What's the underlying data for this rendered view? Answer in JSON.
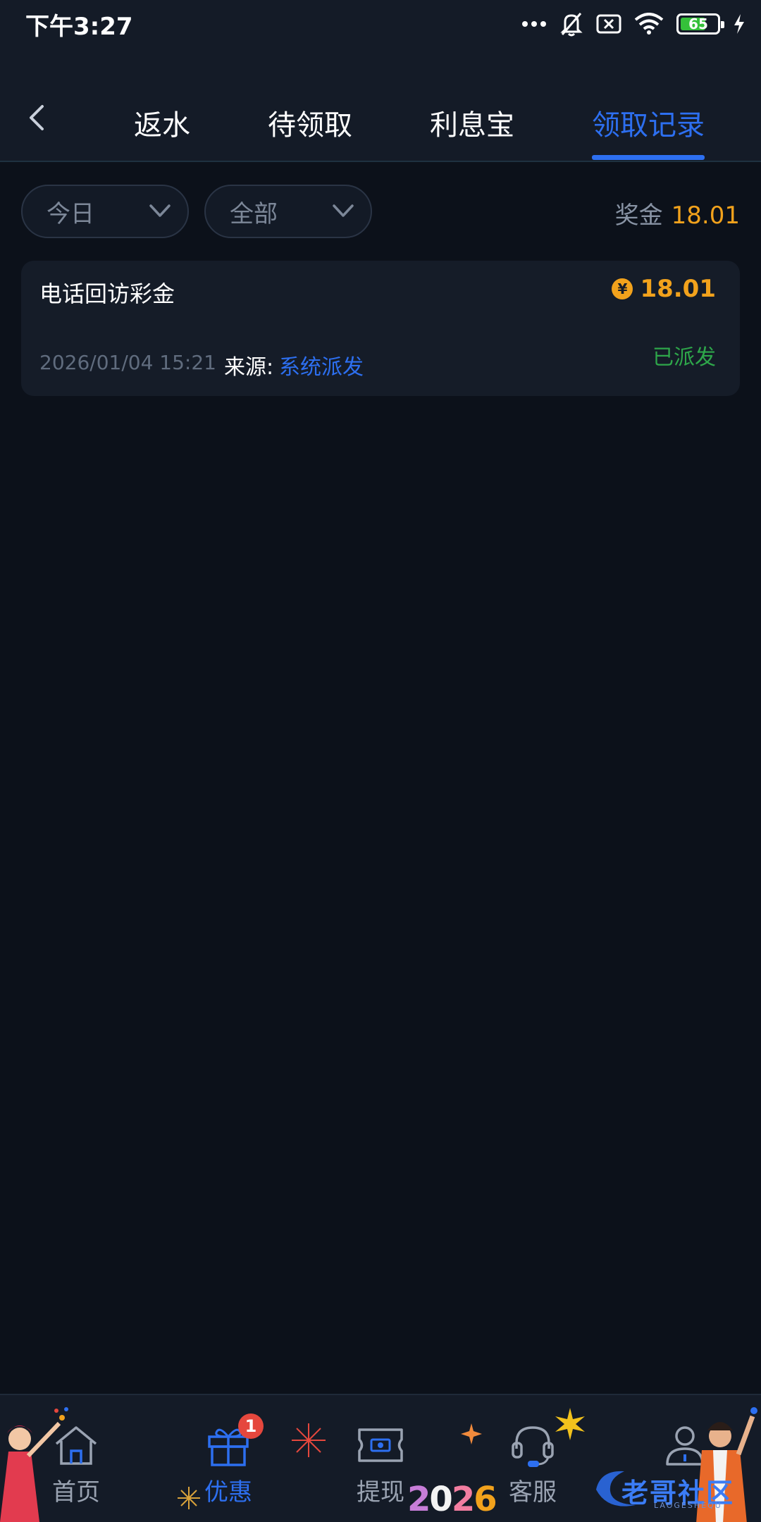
{
  "status_bar": {
    "time": "下午3:27",
    "battery": "65"
  },
  "header": {
    "tabs": [
      {
        "label": "返水"
      },
      {
        "label": "待领取"
      },
      {
        "label": "利息宝"
      },
      {
        "label": "领取记录",
        "active": true
      }
    ]
  },
  "filters": {
    "period": "今日",
    "type": "全部",
    "bonus_label": "奖金",
    "bonus_total": "18.01"
  },
  "records": [
    {
      "title": "电话回访彩金",
      "amount": "18.01",
      "currency_symbol": "¥",
      "datetime": "2026/01/04 15:21",
      "source_label": "来源:",
      "source": "系统派发",
      "status": "已派发"
    }
  ],
  "bottom_nav": {
    "items": [
      {
        "label": "首页",
        "icon": "home-icon"
      },
      {
        "label": "优惠",
        "icon": "gift-icon",
        "active": true,
        "badge": "1"
      },
      {
        "label": "提现",
        "icon": "withdraw-icon"
      },
      {
        "label": "客服",
        "icon": "headset-icon"
      },
      {
        "label": "",
        "icon": "profile-icon"
      }
    ]
  },
  "decorations": {
    "year": "2026",
    "watermark": "老哥社区",
    "watermark_sub": "LAOGESHEQU"
  },
  "colors": {
    "accent": "#2d6ff0",
    "gold": "#f2a21c",
    "success": "#2ea64a",
    "badge": "#e5473d"
  }
}
